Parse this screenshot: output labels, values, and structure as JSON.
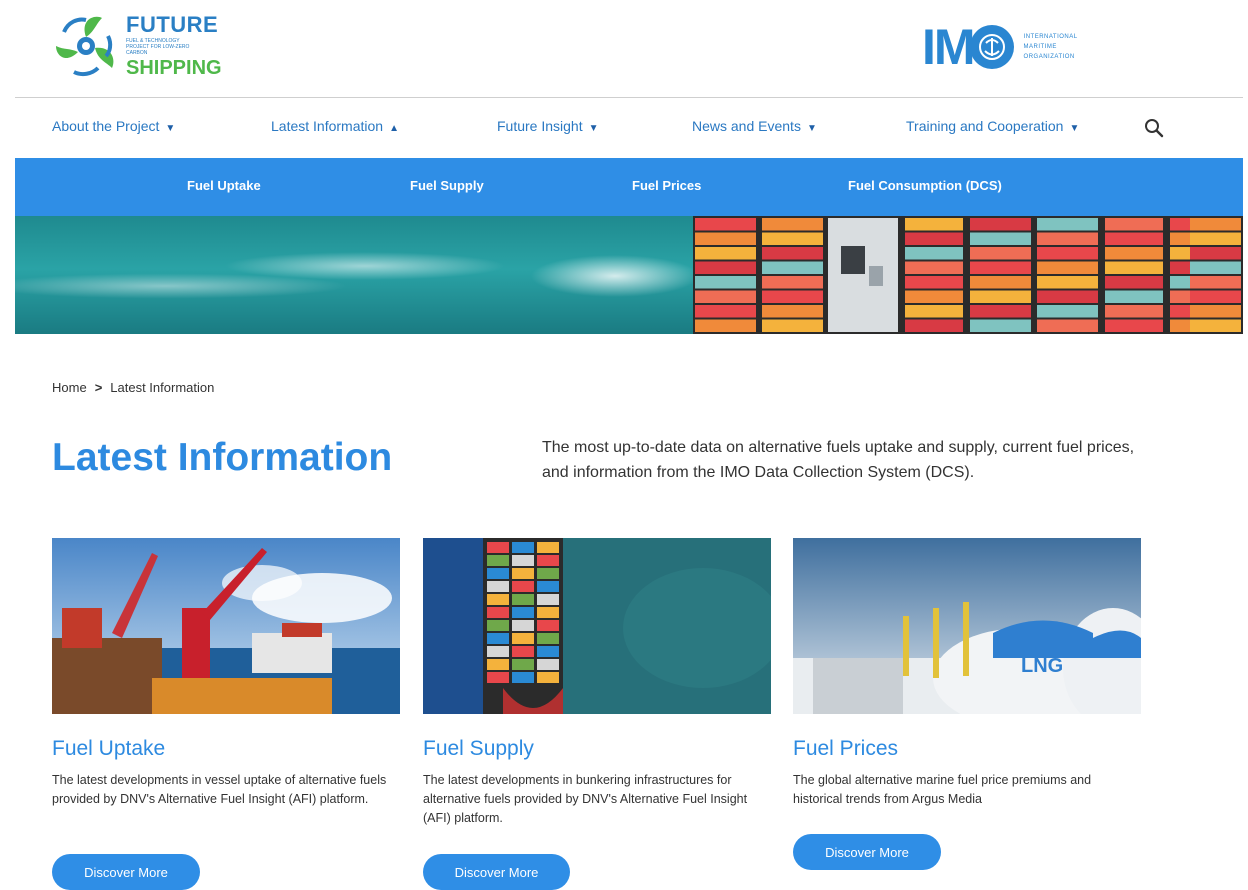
{
  "logo_left": {
    "line1": "FUTURE",
    "line2": "FUEL & TECHNOLOGY PROJECT FOR LOW-ZERO CARBON",
    "line3": "SHIPPING"
  },
  "logo_right": {
    "letters": "IM",
    "sub1": "INTERNATIONAL",
    "sub2": "MARITIME",
    "sub3": "ORGANIZATION"
  },
  "nav": [
    {
      "label": "About the Project",
      "arrow": "▼"
    },
    {
      "label": "Latest Information",
      "arrow": "▲"
    },
    {
      "label": "Future Insight",
      "arrow": "▼"
    },
    {
      "label": "News and Events",
      "arrow": "▼"
    },
    {
      "label": "Training and Cooperation",
      "arrow": "▼"
    }
  ],
  "subnav": [
    "Fuel Uptake",
    "Fuel Supply",
    "Fuel Prices",
    "Fuel Consumption (DCS)"
  ],
  "breadcrumb": {
    "home": "Home",
    "sep": ">",
    "current": "Latest Information"
  },
  "page": {
    "title": "Latest Information",
    "intro": "The most up-to-date data on alternative fuels uptake and supply, current fuel prices, and information from the IMO Data Collection System (DCS)."
  },
  "cards": [
    {
      "title": "Fuel Uptake",
      "desc": "The latest developments in vessel uptake of alternative fuels provided by DNV's Alternative Fuel Insight (AFI) platform.",
      "button": "Discover More"
    },
    {
      "title": "Fuel Supply",
      "desc": "The latest developments in bunkering infrastructures for alternative fuels provided by DNV's Alternative Fuel Insight (AFI) platform.",
      "button": "Discover More"
    },
    {
      "title": "Fuel Prices",
      "desc": "The global alternative marine fuel price premiums and historical trends from Argus Media",
      "button": "Discover More",
      "image_text": "LNG"
    }
  ],
  "colors": {
    "brand_blue": "#2f8ee6",
    "link_blue": "#2a78c2",
    "green": "#4fb84a"
  }
}
